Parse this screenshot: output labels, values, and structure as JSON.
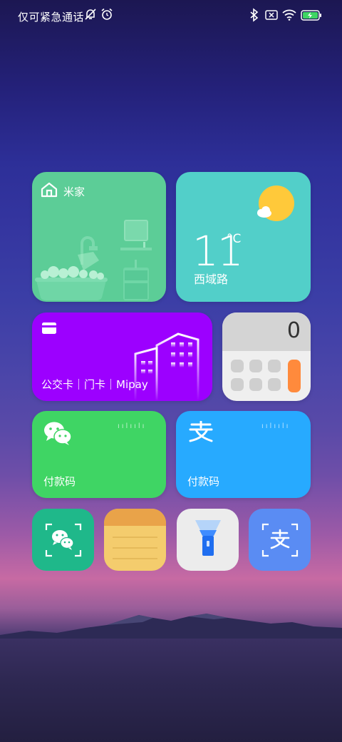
{
  "status_bar": {
    "carrier_text": "仅可紧急通话",
    "icons": [
      "silent-bell-icon",
      "alarm-icon",
      "bluetooth-icon",
      "no-sim-icon",
      "wifi-icon",
      "battery-charging-icon"
    ]
  },
  "widgets": {
    "mijia": {
      "label": "米家",
      "icon": "home-icon"
    },
    "weather": {
      "temperature": "11",
      "unit": "°C",
      "location": "西域路",
      "icon": "sun-cloud-icon"
    },
    "card": {
      "label": "公交卡｜门卡｜Mipay",
      "icon": "card-icon"
    },
    "calculator": {
      "display": "0"
    },
    "wechat_pay": {
      "label": "付款码",
      "icon": "wechat-icon",
      "barcode": "ıılıılı"
    },
    "alipay": {
      "label": "付款码",
      "icon": "alipay-icon",
      "barcode": "ıılıılı"
    }
  },
  "apps": [
    {
      "name": "wechat-scan",
      "icon": "wechat-scan-icon"
    },
    {
      "name": "notes",
      "icon": "notes-icon"
    },
    {
      "name": "flashlight",
      "icon": "flashlight-icon"
    },
    {
      "name": "alipay-scan",
      "icon": "alipay-scan-icon"
    }
  ],
  "colors": {
    "mijia": "#5ccd97",
    "weather": "#52cfc9",
    "card": "#9c00ff",
    "calculator": "#efefef",
    "wechat_pay": "#3fd564",
    "alipay": "#27aaff",
    "calc_accent": "#ff8a3c"
  }
}
